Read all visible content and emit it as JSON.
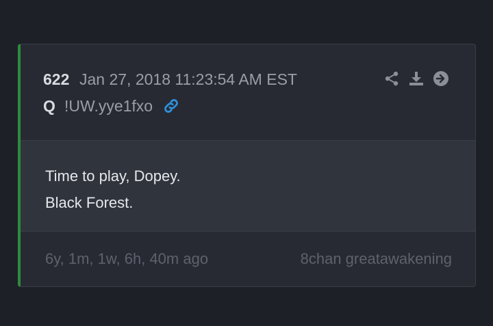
{
  "post": {
    "number": "622",
    "timestamp": "Jan 27, 2018 11:23:54 AM EST",
    "author": "Q",
    "tripcode": "!UW.yye1fxo",
    "body_lines": [
      "Time to play, Dopey.",
      "Black Forest."
    ],
    "relative_time": "6y, 1m, 1w, 6h, 40m ago",
    "source": "8chan greatawakening"
  },
  "icons": {
    "link": "link-icon",
    "share": "share-icon",
    "download": "download-icon",
    "next": "arrow-right-circle-icon"
  },
  "colors": {
    "accent_border": "#2e8b3d",
    "link_icon": "#2f8fd8",
    "background": "#1e2028"
  }
}
